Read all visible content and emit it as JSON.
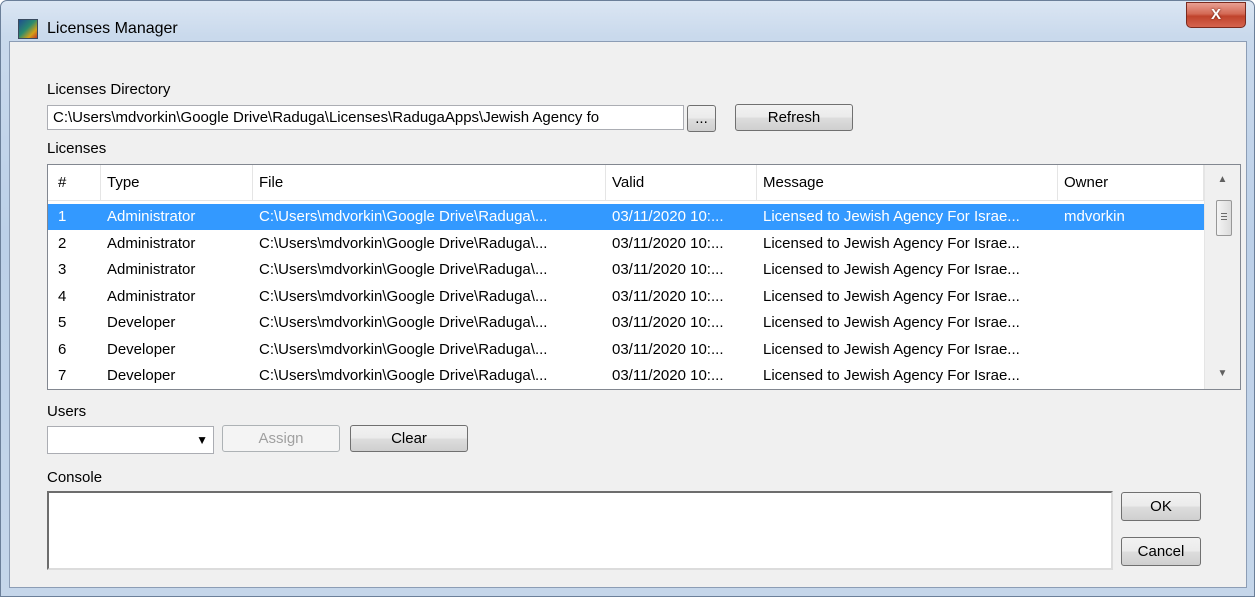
{
  "window": {
    "title": "Licenses Manager",
    "close_label": "X"
  },
  "directory": {
    "label": "Licenses Directory",
    "value": "C:\\Users\\mdvorkin\\Google Drive\\Raduga\\Licenses\\RadugaApps\\Jewish Agency fo",
    "browse_label": "...",
    "refresh_label": "Refresh"
  },
  "licenses": {
    "label": "Licenses",
    "columns": [
      "#",
      "Type",
      "File",
      "Valid",
      "Message",
      "Owner"
    ],
    "rows": [
      {
        "num": "1",
        "type": "Administrator",
        "file": "C:\\Users\\mdvorkin\\Google Drive\\Raduga\\...",
        "valid": "03/11/2020 10:...",
        "message": "Licensed to Jewish Agency For Israe...",
        "owner": "mdvorkin"
      },
      {
        "num": "2",
        "type": "Administrator",
        "file": "C:\\Users\\mdvorkin\\Google Drive\\Raduga\\...",
        "valid": "03/11/2020 10:...",
        "message": "Licensed to Jewish Agency For Israe...",
        "owner": ""
      },
      {
        "num": "3",
        "type": "Administrator",
        "file": "C:\\Users\\mdvorkin\\Google Drive\\Raduga\\...",
        "valid": "03/11/2020 10:...",
        "message": "Licensed to Jewish Agency For Israe...",
        "owner": ""
      },
      {
        "num": "4",
        "type": "Administrator",
        "file": "C:\\Users\\mdvorkin\\Google Drive\\Raduga\\...",
        "valid": "03/11/2020 10:...",
        "message": "Licensed to Jewish Agency For Israe...",
        "owner": ""
      },
      {
        "num": "5",
        "type": "Developer",
        "file": "C:\\Users\\mdvorkin\\Google Drive\\Raduga\\...",
        "valid": "03/11/2020 10:...",
        "message": "Licensed to Jewish Agency For Israe...",
        "owner": ""
      },
      {
        "num": "6",
        "type": "Developer",
        "file": "C:\\Users\\mdvorkin\\Google Drive\\Raduga\\...",
        "valid": "03/11/2020 10:...",
        "message": "Licensed to Jewish Agency For Israe...",
        "owner": ""
      },
      {
        "num": "7",
        "type": "Developer",
        "file": "C:\\Users\\mdvorkin\\Google Drive\\Raduga\\...",
        "valid": "03/11/2020 10:...",
        "message": "Licensed to Jewish Agency For Israe...",
        "owner": ""
      }
    ],
    "selected_row": 0
  },
  "users": {
    "label": "Users",
    "selected": "",
    "assign_label": "Assign",
    "clear_label": "Clear"
  },
  "console": {
    "label": "Console",
    "value": ""
  },
  "buttons": {
    "ok_label": "OK",
    "cancel_label": "Cancel"
  },
  "colors": {
    "selection": "#3399ff",
    "close_button": "#c0432c"
  }
}
